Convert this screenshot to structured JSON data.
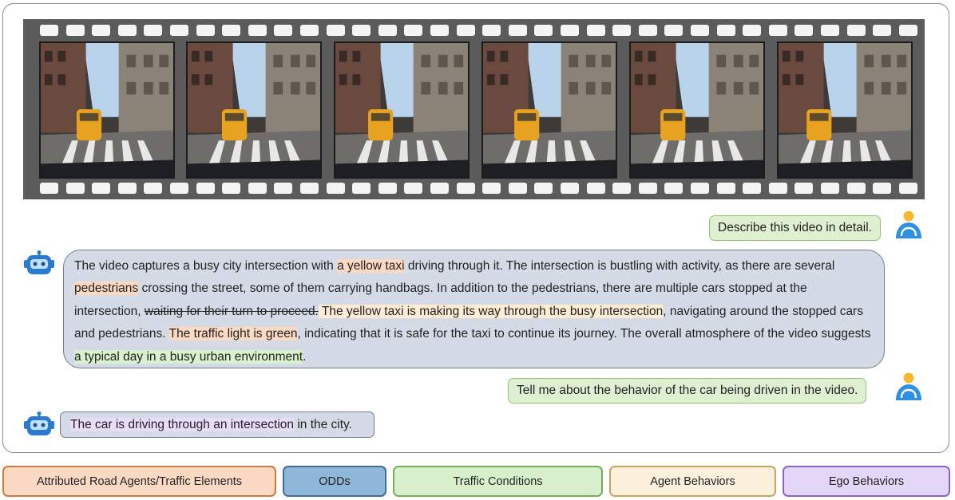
{
  "conversation": {
    "q1": "Describe this video in detail.",
    "a1": {
      "t1": "The video captures a busy city intersection with ",
      "h1": "a yellow taxi",
      "t2": " driving through it. The intersection is bustling with activity, as there are several ",
      "h2": "pedestrians",
      "t3": " crossing the street, some of them carrying handbags. In addition to the pedestrians, there are multiple cars stopped at the intersection, ",
      "strike": "waiting for their turn to proceed.",
      "h3": " The yellow taxi is making its way through the busy intersection",
      "t4": ", navigating around the stopped cars and pedestrians. ",
      "h4": "The traffic light is green",
      "t5": ", indicating that it is safe for the taxi to continue its journey. The overall atmosphere of the video suggests ",
      "h5": "a typical day in a busy urban environment",
      "t6": "."
    },
    "q2": "Tell me about the behavior of the car being driven in the video.",
    "a2": {
      "h1": "The car is driving through an intersection",
      "t1": " in the city."
    }
  },
  "legend": [
    {
      "label": "Attributed Road Agents/Traffic Elements",
      "bg": "#fbd9c3",
      "border": "#d0793a"
    },
    {
      "label": "ODDs",
      "bg": "#8fb7d9",
      "border": "#3f6f98"
    },
    {
      "label": "Traffic Conditions",
      "bg": "#d8efcb",
      "border": "#78ad55"
    },
    {
      "label": "Agent Behaviors",
      "bg": "#fbf0dc",
      "border": "#caa45a"
    },
    {
      "label": "Ego Behaviors",
      "bg": "#e4d6f7",
      "border": "#8a63c8"
    }
  ],
  "icons": {
    "user": "user-icon",
    "bot": "robot-icon"
  },
  "colors": {
    "user_bubble": "#dff0d2",
    "bot_bubble": "#d5dbe6",
    "film": "#5b5b5b"
  }
}
